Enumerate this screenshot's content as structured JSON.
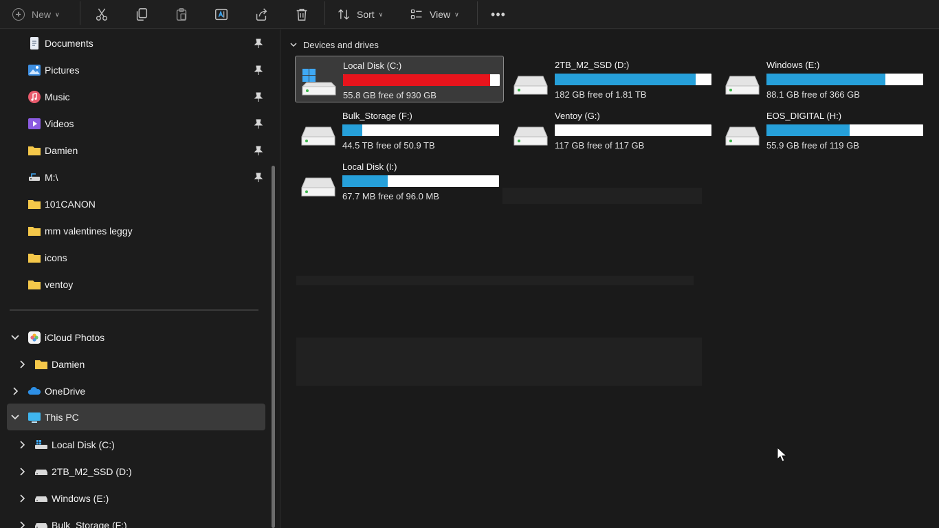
{
  "toolbar": {
    "new_label": "New",
    "sort_label": "Sort",
    "view_label": "View",
    "more_label": "•••"
  },
  "sidebar": {
    "quick_access": [
      {
        "label": "Documents",
        "icon": "document-icon",
        "pinned": true
      },
      {
        "label": "Pictures",
        "icon": "pictures-icon",
        "pinned": true
      },
      {
        "label": "Music",
        "icon": "music-icon",
        "pinned": true
      },
      {
        "label": "Videos",
        "icon": "videos-icon",
        "pinned": true
      },
      {
        "label": "Damien",
        "icon": "folder-icon",
        "pinned": true
      },
      {
        "label": "M:\\",
        "icon": "network-drive-icon",
        "pinned": true
      },
      {
        "label": "101CANON",
        "icon": "folder-icon",
        "pinned": false
      },
      {
        "label": "mm valentines leggy",
        "icon": "folder-icon",
        "pinned": false
      },
      {
        "label": "icons",
        "icon": "folder-icon",
        "pinned": false
      },
      {
        "label": "ventoy",
        "icon": "folder-icon",
        "pinned": false
      }
    ],
    "tree": [
      {
        "label": "iCloud Photos",
        "icon": "icloud-photos-icon",
        "expanded": true,
        "level": 0
      },
      {
        "label": "Damien",
        "icon": "folder-icon",
        "expanded": false,
        "level": 1
      },
      {
        "label": "OneDrive",
        "icon": "onedrive-icon",
        "expanded": false,
        "level": 0
      },
      {
        "label": "This PC",
        "icon": "this-pc-icon",
        "expanded": true,
        "level": 0,
        "selected": true
      },
      {
        "label": "Local Disk (C:)",
        "icon": "system-drive-icon",
        "expanded": false,
        "level": 1
      },
      {
        "label": "2TB_M2_SSD (D:)",
        "icon": "drive-icon",
        "expanded": false,
        "level": 1
      },
      {
        "label": "Windows (E:)",
        "icon": "drive-icon",
        "expanded": false,
        "level": 1
      },
      {
        "label": "Bulk_Storage (F:)",
        "icon": "drive-icon",
        "expanded": false,
        "level": 1
      }
    ]
  },
  "main": {
    "group_title": "Devices and drives",
    "drives": [
      {
        "name": "Local Disk (C:)",
        "free_text": "55.8 GB free of 930 GB",
        "used_fraction": 0.94,
        "bar_color": "#e8141c",
        "system": true,
        "selected": true
      },
      {
        "name": "2TB_M2_SSD (D:)",
        "free_text": "182 GB free of 1.81 TB",
        "used_fraction": 0.9,
        "bar_color": "#26a0da",
        "system": false,
        "selected": false
      },
      {
        "name": "Windows (E:)",
        "free_text": "88.1 GB free of 366 GB",
        "used_fraction": 0.76,
        "bar_color": "#26a0da",
        "system": false,
        "selected": false
      },
      {
        "name": "Bulk_Storage (F:)",
        "free_text": "44.5 TB free of 50.9 TB",
        "used_fraction": 0.125,
        "bar_color": "#26a0da",
        "system": false,
        "selected": false
      },
      {
        "name": "Ventoy (G:)",
        "free_text": "117 GB free of 117 GB",
        "used_fraction": 0.0,
        "bar_color": "#26a0da",
        "system": false,
        "selected": false
      },
      {
        "name": "EOS_DIGITAL (H:)",
        "free_text": "55.9 GB free of 119 GB",
        "used_fraction": 0.53,
        "bar_color": "#26a0da",
        "system": false,
        "selected": false
      },
      {
        "name": "Local Disk (I:)",
        "free_text": "67.7 MB free of 96.0 MB",
        "used_fraction": 0.29,
        "bar_color": "#26a0da",
        "system": false,
        "selected": false
      }
    ]
  }
}
